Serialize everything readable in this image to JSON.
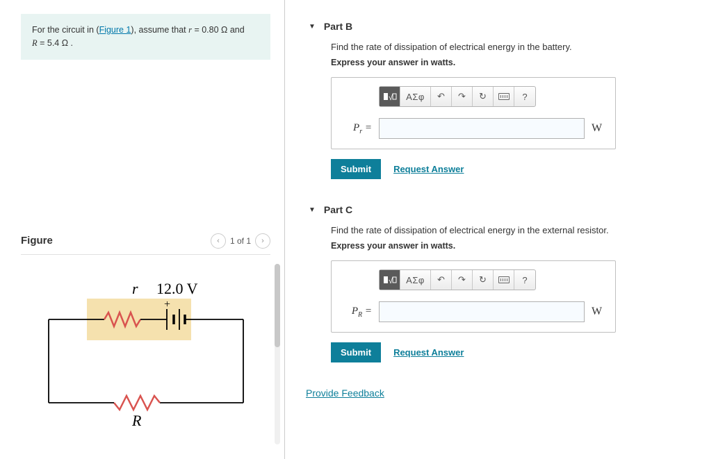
{
  "problem": {
    "prefix": "For the circuit in (",
    "figure_link": "Figure 1",
    "mid": "), assume that ",
    "r_var": "r",
    "r_eq": " = 0.80 Ω and ",
    "R_var": "R",
    "R_eq": " = 5.4 Ω ."
  },
  "figure": {
    "heading": "Figure",
    "nav_text": "1 of 1",
    "r_label": "r",
    "voltage_label": "12.0 V",
    "plus": "+",
    "R_label": "R"
  },
  "toolbar": {
    "templates_icon": "▮√▯",
    "greek": "ΑΣφ",
    "undo": "↶",
    "redo": "↷",
    "reset": "↻",
    "keyboard": "⌨",
    "help": "?"
  },
  "partB": {
    "title": "Part B",
    "prompt": "Find the rate of dissipation of electrical energy in the battery.",
    "instruction": "Express your answer in watts.",
    "var_html": "P",
    "var_sub": "r",
    "equals": " =",
    "unit": "W",
    "submit": "Submit",
    "request": "Request Answer"
  },
  "partC": {
    "title": "Part C",
    "prompt": "Find the rate of dissipation of electrical energy in the external resistor.",
    "instruction": "Express your answer in watts.",
    "var_html": "P",
    "var_sub": "R",
    "equals": " =",
    "unit": "W",
    "submit": "Submit",
    "request": "Request Answer"
  },
  "feedback": "Provide Feedback"
}
